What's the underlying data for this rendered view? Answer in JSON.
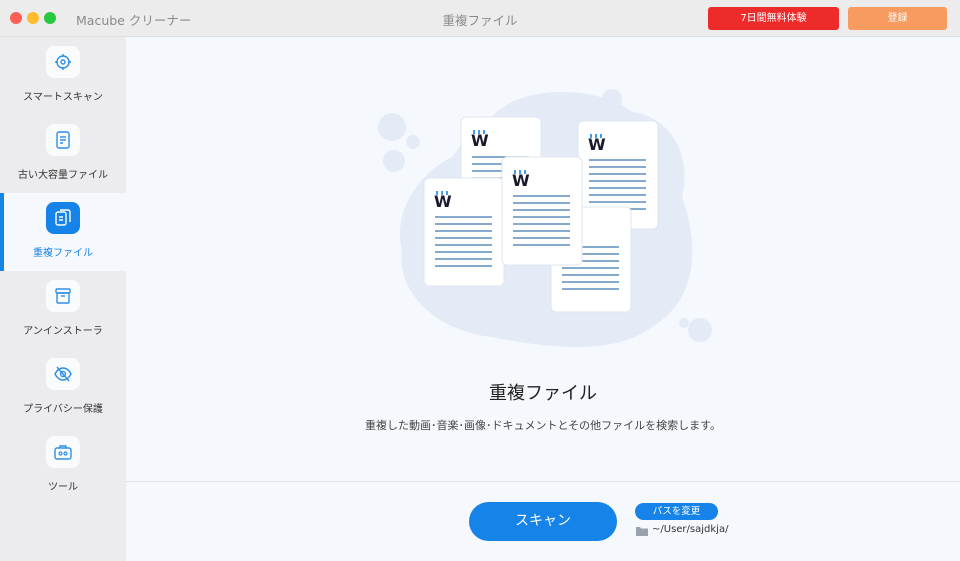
{
  "titlebar": {
    "app_name": "Macube クリーナー",
    "window_title": "重複ファイル",
    "trial_button": "7日間無料体験",
    "register_button": "登録"
  },
  "sidebar": {
    "items": [
      {
        "label": "スマートスキャン",
        "icon": "crosshair-icon",
        "active": false
      },
      {
        "label": "古い大容量ファイル",
        "icon": "document-icon",
        "active": false
      },
      {
        "label": "重複ファイル",
        "icon": "duplicate-files-icon",
        "active": true
      },
      {
        "label": "アンインストーラ",
        "icon": "box-icon",
        "active": false
      },
      {
        "label": "プライバシー保護",
        "icon": "eye-slash-icon",
        "active": false
      },
      {
        "label": "ツール",
        "icon": "toolbox-icon",
        "active": false
      }
    ]
  },
  "main": {
    "title": "重複ファイル",
    "description": "重複した動画･音楽･画像･ドキュメントとその他ファイルを検索します。",
    "scan_button": "スキャン",
    "change_path_button": "パスを変更",
    "path": "~/User/sajdkja/"
  },
  "colors": {
    "accent": "#1683e8",
    "trial": "#ee2b2b",
    "register": "#f79b5e"
  }
}
